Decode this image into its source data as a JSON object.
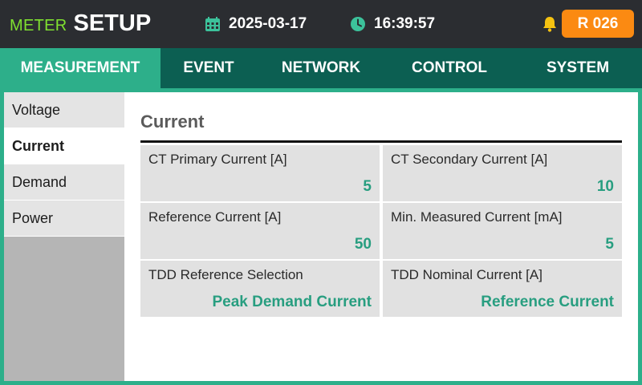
{
  "header": {
    "brand_prefix": "METER",
    "brand_title": "SETUP",
    "date": "2025-03-17",
    "time": "16:39:57",
    "revision_badge": "R 026",
    "icons": {
      "date": "calendar-icon",
      "time": "clock-icon",
      "alert": "bell-icon"
    },
    "colors": {
      "brand_prefix": "#7fe030",
      "badge": "#fb8a12",
      "icon_accent": "#3cc29b",
      "bell": "#f5c211"
    }
  },
  "tabs": [
    {
      "label": "MEASUREMENT",
      "active": true
    },
    {
      "label": "EVENT",
      "active": false
    },
    {
      "label": "NETWORK",
      "active": false
    },
    {
      "label": "CONTROL",
      "active": false
    },
    {
      "label": "SYSTEM",
      "active": false
    }
  ],
  "sidebar": {
    "items": [
      {
        "label": "Voltage",
        "active": false
      },
      {
        "label": "Current",
        "active": true
      },
      {
        "label": "Demand",
        "active": false
      },
      {
        "label": "Power",
        "active": false
      }
    ]
  },
  "main": {
    "title": "Current",
    "fields": [
      {
        "label": "CT Primary Current [A]",
        "value": "5"
      },
      {
        "label": "CT Secondary Current [A]",
        "value": "10"
      },
      {
        "label": "Reference Current [A]",
        "value": "50"
      },
      {
        "label": "Min. Measured Current [mA]",
        "value": "5"
      },
      {
        "label": "TDD Reference Selection",
        "value": "Peak Demand Current"
      },
      {
        "label": "TDD Nominal Current [A]",
        "value": "Reference Current"
      }
    ]
  },
  "theme": {
    "accent": "#2daf8a",
    "tabbar": "#0c5f52",
    "header_bg": "#2b2d31",
    "value_text": "#289e80"
  }
}
